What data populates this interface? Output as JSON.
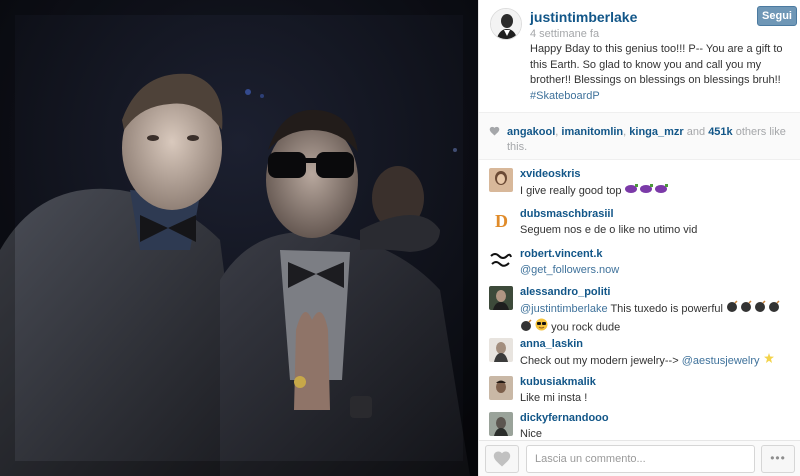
{
  "post": {
    "owner_username": "justintimberlake",
    "follow_label": "Segui",
    "time_ago": "4 settimane fa",
    "caption_text": "Happy Bday to this genius too!!! P-- You are a gift to this Earth. So glad to know you and call you my brother!! Blessings on blessings on blessings bruh!!",
    "caption_hashtag": "#SkateboardP"
  },
  "likes": {
    "user1": "angakool",
    "user2": "imanitomlin",
    "user3": "kinga_mzr",
    "and_label": "and",
    "count": "451k",
    "suffix": "others like this."
  },
  "comments": [
    {
      "username": "xvideoskris",
      "text": "I give really good top",
      "emoji": "eggplant",
      "emoji_count": 3
    },
    {
      "username": "dubsmaschbrasiil",
      "text": "Seguem nos e de o like no utimo vid"
    },
    {
      "username": "robert.vincent.k",
      "mention": "@get_followers.now"
    },
    {
      "username": "alessandro_politi",
      "mention": "@justintimberlake",
      "text": "This tuxedo is powerful",
      "text2": "you rock dude",
      "emoji": "bomb"
    },
    {
      "username": "anna_laskin",
      "text": "Check out my modern jewelry-->",
      "mention": "@aestusjewelry",
      "emoji": "dizzy"
    },
    {
      "username": "kubusiakmalik",
      "text": "Like mi insta !"
    },
    {
      "username": "dickyfernandooo",
      "text": "Nice"
    }
  ],
  "comment_box": {
    "placeholder": "Lascia un commento..."
  },
  "icons": {
    "heart": "heart-icon",
    "more": "more-options-icon"
  },
  "colors": {
    "link": "#125688",
    "follow_button": "#6f97b6",
    "muted": "#a5a7aa"
  }
}
